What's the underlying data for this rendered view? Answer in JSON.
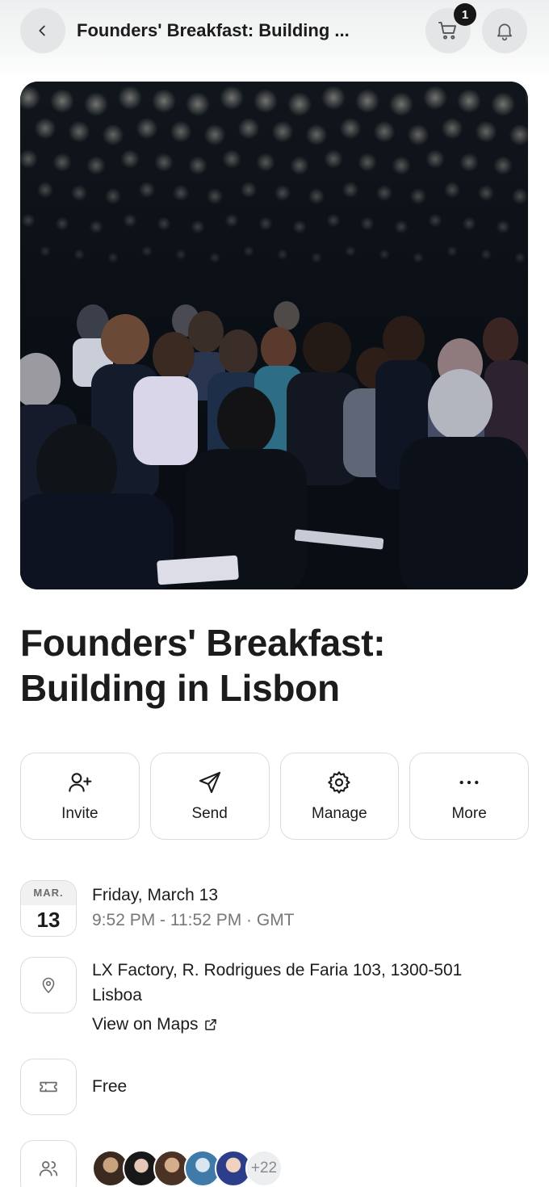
{
  "header": {
    "title": "Founders' Breakfast: Building ...",
    "cart_count": "1",
    "icons": {
      "back": "chevron-left-icon",
      "cart": "cart-icon",
      "notifications": "bell-icon"
    }
  },
  "event": {
    "title_line1": "Founders' Breakfast:",
    "title_line2": "Building in Lisbon"
  },
  "actions": [
    {
      "label": "Invite",
      "icon": "user-plus-icon"
    },
    {
      "label": "Send",
      "icon": "send-icon"
    },
    {
      "label": "Manage",
      "icon": "gear-icon"
    },
    {
      "label": "More",
      "icon": "more-icon"
    }
  ],
  "date": {
    "month": "MAR.",
    "day": "13",
    "full_date": "Friday, March 13",
    "time": "9:52 PM - 11:52 PM · GMT"
  },
  "location": {
    "line1": "LX Factory, R. Rodrigues de Faria 103, 1300-501",
    "line2": "Lisboa",
    "maps_link": "View on Maps"
  },
  "price": {
    "label": "Free"
  },
  "attendees": {
    "more_count": "+22"
  },
  "colors": {
    "accent": "#1c1c1e",
    "muted": "#77777c",
    "border": "#dcdcde"
  }
}
